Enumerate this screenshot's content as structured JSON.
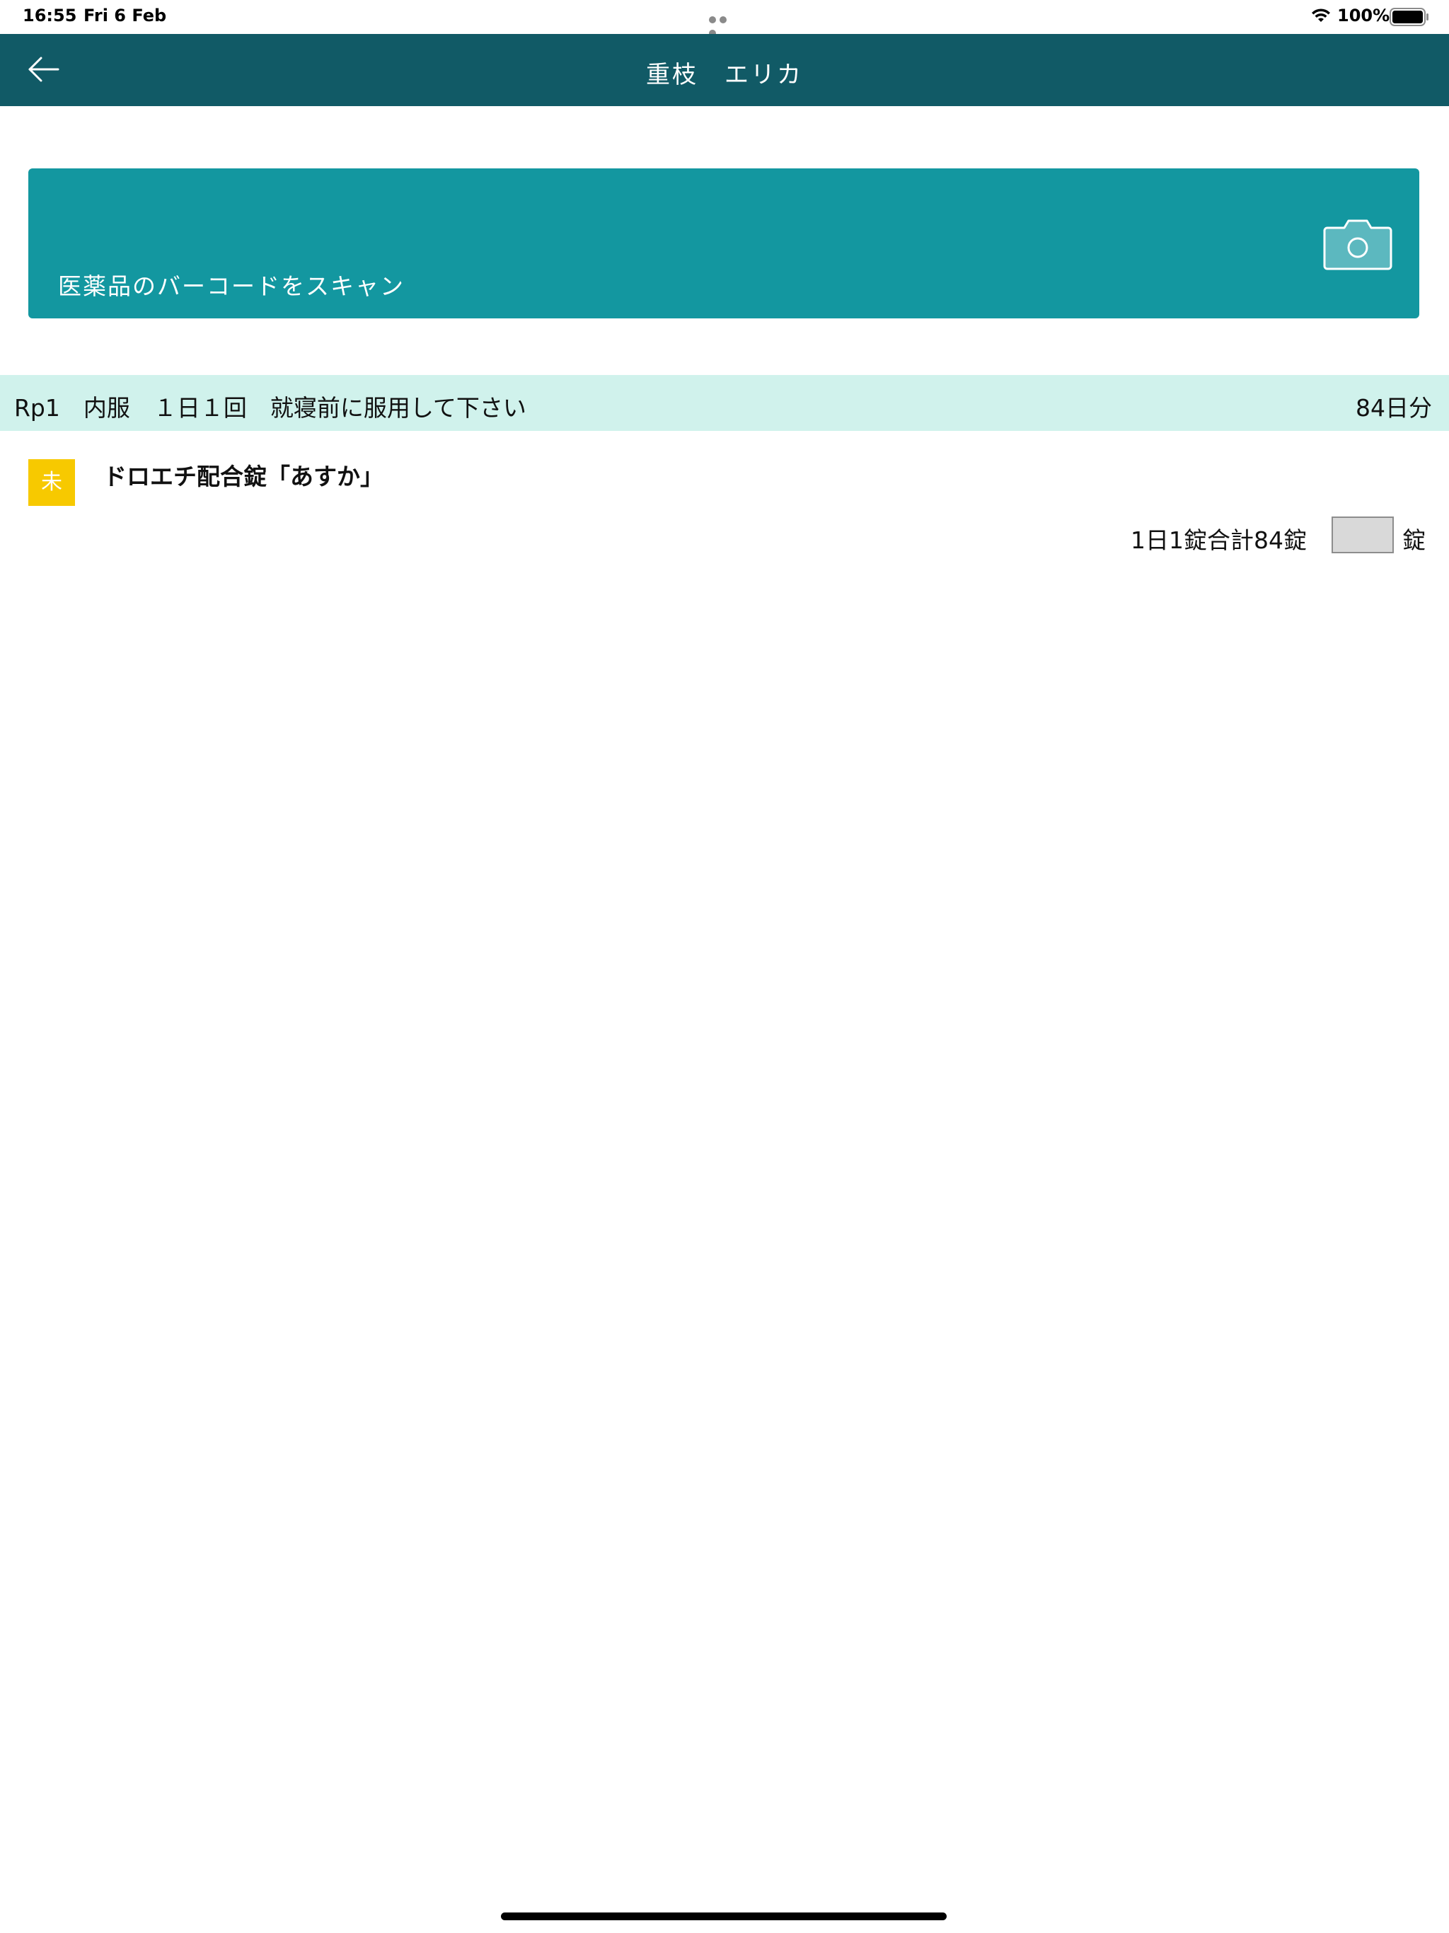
{
  "status_bar": {
    "time": "16:55",
    "date": "Fri 6 Feb",
    "battery": "100%"
  },
  "nav": {
    "title": "重枝　エリカ",
    "back_icon": "arrow-left-icon"
  },
  "scan": {
    "label": "医薬品のバーコードをスキャン",
    "icon": "camera-icon"
  },
  "rp": {
    "label": "Rp1　内服　１日１回　就寝前に服用して下さい",
    "days": "84日分"
  },
  "drug": {
    "status": "未",
    "name": "ドロエチ配合錠「あすか」",
    "dose": "1日1錠合計84錠",
    "count_value": "",
    "unit": "錠"
  },
  "colors": {
    "nav_bg": "#115a66",
    "banner_bg": "#1397a0",
    "rp_header_bg": "#d0f2ec",
    "badge_bg": "#f7c900"
  }
}
